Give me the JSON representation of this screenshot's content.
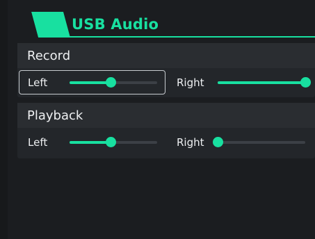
{
  "header": {
    "title": "USB Audio"
  },
  "colors": {
    "accent": "#18e0a0",
    "background": "#17191b",
    "panel": "#23262a",
    "track": "#3c4046"
  },
  "sections": [
    {
      "title": "Record",
      "sliders": [
        {
          "label": "Left",
          "value": 0.47,
          "focused": true
        },
        {
          "label": "Right",
          "value": 1.0,
          "focused": false
        }
      ]
    },
    {
      "title": "Playback",
      "sliders": [
        {
          "label": "Left",
          "value": 0.47,
          "focused": false
        },
        {
          "label": "Right",
          "value": 0.0,
          "focused": false
        }
      ]
    }
  ]
}
